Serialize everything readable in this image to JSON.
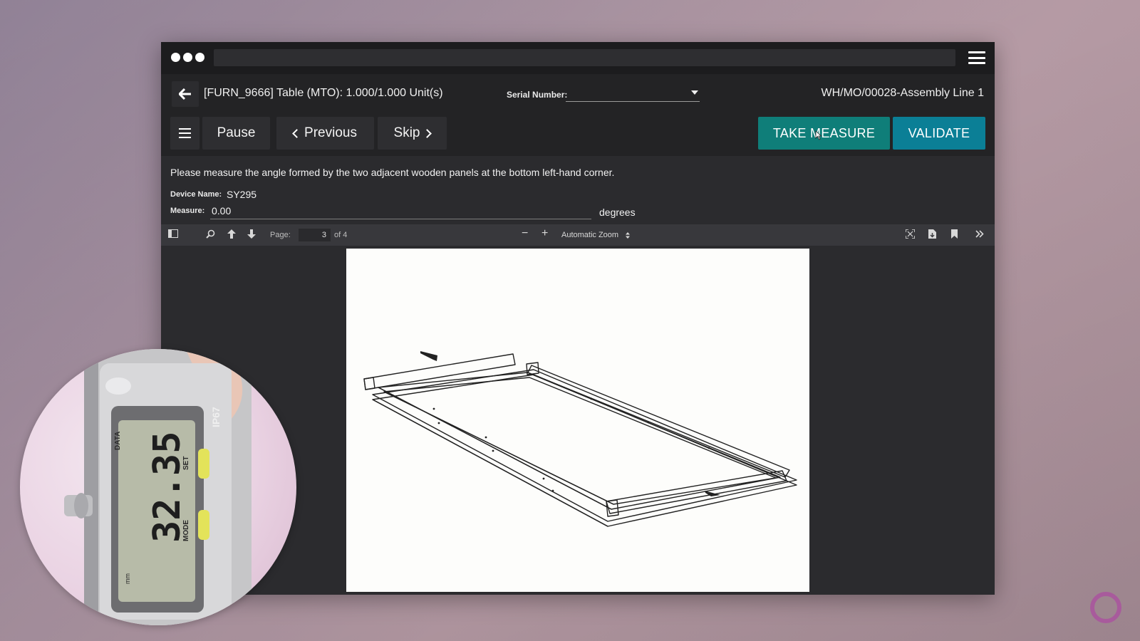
{
  "window": {
    "menu_icon": "hamburger-icon"
  },
  "header": {
    "back_icon": "arrow-left-icon",
    "product_title": "[FURN_9666] Table (MTO): 1.000/1.000 Unit(s)",
    "serial_label": "Serial Number:",
    "serial_value": "",
    "work_order_ref": "WH/MO/00028-Assembly Line 1"
  },
  "toolbar": {
    "pause_label": "Pause",
    "previous_label": "Previous",
    "skip_label": "Skip",
    "take_measure_label": "TAKE MEASURE",
    "validate_label": "VALIDATE",
    "accent_measure": "#0f7e79",
    "accent_validate": "#0b7f96"
  },
  "step": {
    "instruction": "Please measure the angle formed by the two adjacent wooden panels at the bottom left-hand corner.",
    "device_label": "Device Name:",
    "device_value": "SY295",
    "measure_label": "Measure:",
    "measure_value": "0.00",
    "measure_unit": "degrees"
  },
  "pdf": {
    "page_label": "Page:",
    "page_current": "3",
    "page_of": "of 4",
    "zoom_label": "Automatic Zoom"
  },
  "caliper": {
    "reading": "32.35",
    "data_label": "DATA",
    "set_label": "SET",
    "mode_label": "MODE",
    "ip_label": "IP67",
    "unit_label": "mm"
  }
}
